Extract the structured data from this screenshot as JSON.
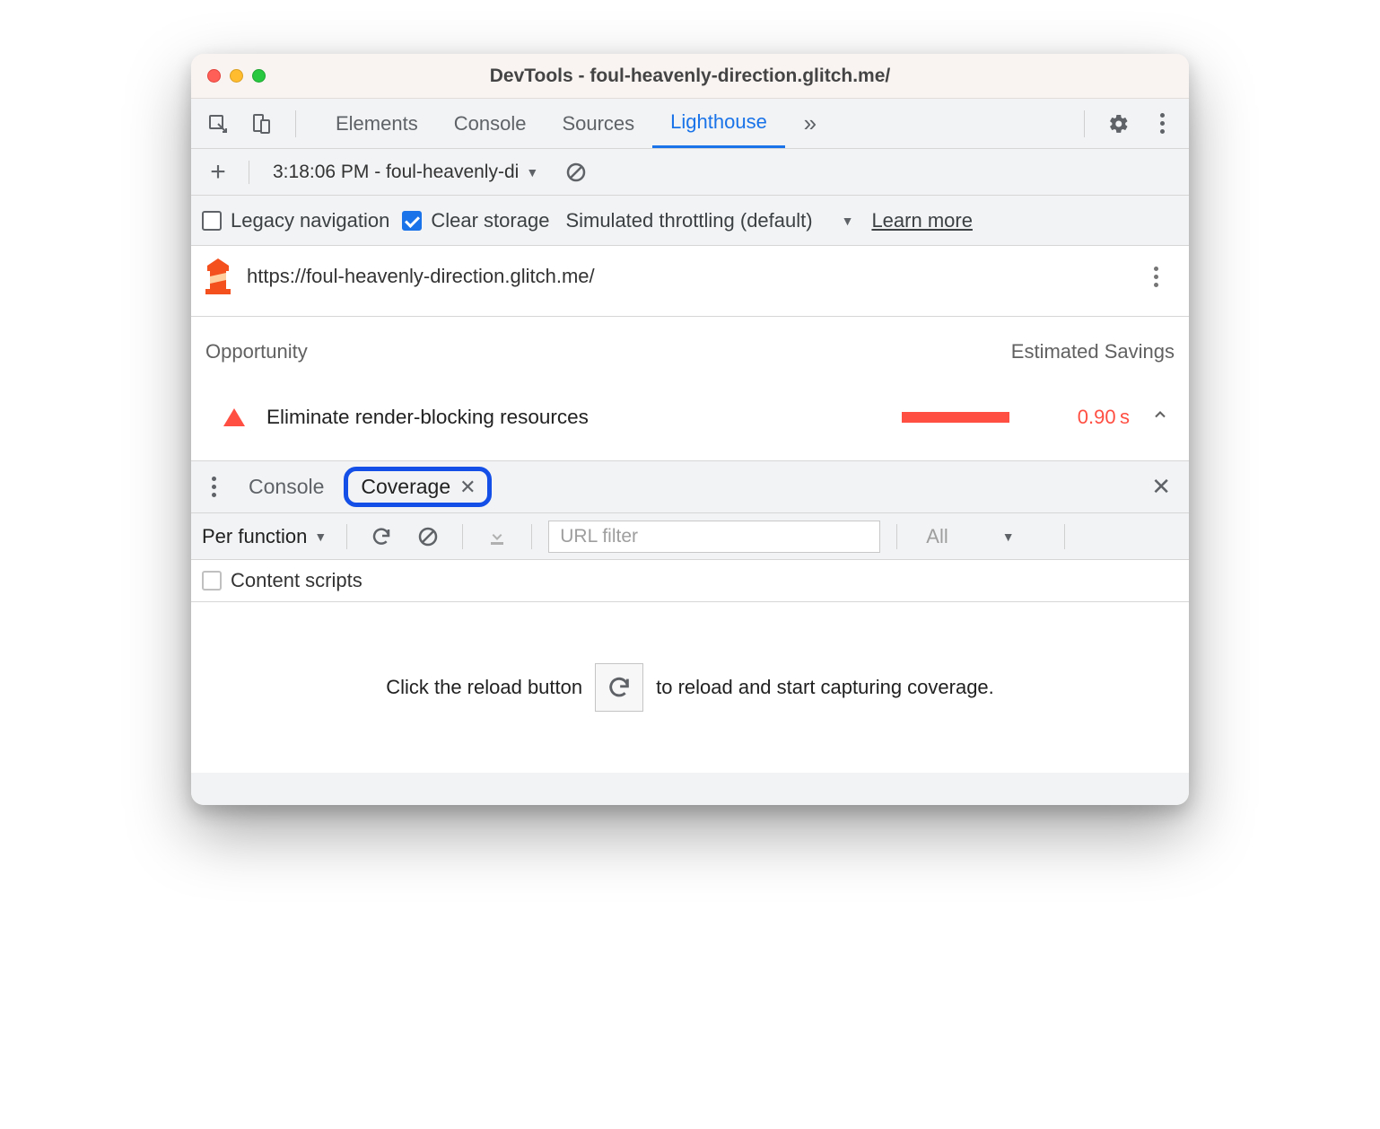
{
  "window": {
    "title": "DevTools - foul-heavenly-direction.glitch.me/"
  },
  "tabs": {
    "items": [
      "Elements",
      "Console",
      "Sources",
      "Lighthouse"
    ],
    "active": "Lighthouse"
  },
  "toolbar2": {
    "report_label": "3:18:06 PM - foul-heavenly-di"
  },
  "options": {
    "legacy_label": "Legacy navigation",
    "clear_label": "Clear storage",
    "throttling_label": "Simulated throttling (default)",
    "learn_label": "Learn more"
  },
  "lighthouse": {
    "url": "https://foul-heavenly-direction.glitch.me/",
    "col_opportunity": "Opportunity",
    "col_savings": "Estimated Savings",
    "opportunities": [
      {
        "label": "Eliminate render-blocking resources",
        "savings": "0.90 s"
      }
    ]
  },
  "drawer": {
    "tabs": {
      "console": "Console",
      "coverage": "Coverage"
    }
  },
  "coverage": {
    "granularity": "Per function",
    "url_filter_placeholder": "URL filter",
    "type_filter": "All",
    "content_scripts_label": "Content scripts",
    "hint_pre": "Click the reload button",
    "hint_post": "to reload and start capturing coverage."
  }
}
